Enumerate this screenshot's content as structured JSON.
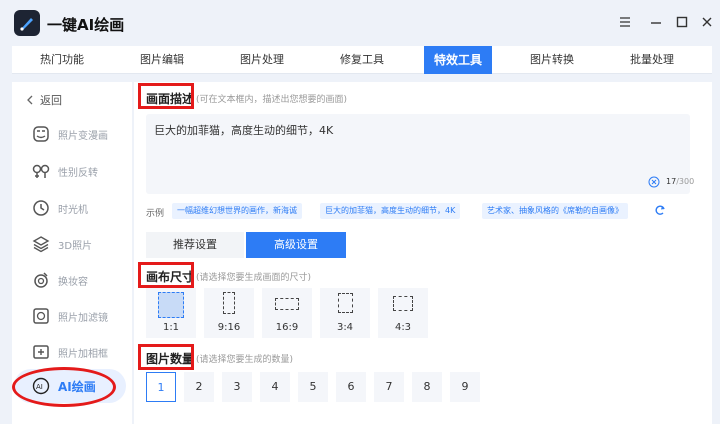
{
  "app": {
    "title": "一键AI绘画"
  },
  "tabs": [
    {
      "label": "热门功能"
    },
    {
      "label": "图片编辑"
    },
    {
      "label": "图片处理"
    },
    {
      "label": "修复工具"
    },
    {
      "label": "特效工具",
      "active": true
    },
    {
      "label": "图片转换"
    },
    {
      "label": "批量处理"
    }
  ],
  "sidebar": {
    "back_label": "返回",
    "items": [
      {
        "label": "照片变漫画",
        "icon": "cartoon-face-icon"
      },
      {
        "label": "性别反转",
        "icon": "gender-icon"
      },
      {
        "label": "时光机",
        "icon": "time-machine-icon"
      },
      {
        "label": "3D照片",
        "icon": "layers-icon"
      },
      {
        "label": "换妆容",
        "icon": "makeup-icon"
      },
      {
        "label": "照片加滤镜",
        "icon": "filter-icon"
      },
      {
        "label": "照片加相框",
        "icon": "frame-icon"
      },
      {
        "label": "AI绘画",
        "icon": "ai-paint-icon",
        "active": true
      }
    ]
  },
  "description": {
    "title": "画面描述",
    "hint": "(可在文本框内，描述出您想要的画面)",
    "value": "巨大的加菲猫，高度生动的细节，4K",
    "count": "17",
    "max": "/300"
  },
  "examples": {
    "label": "示例",
    "chips": [
      "一幅超维幻想世界的画作，新海诚",
      "巨大的加菲猫，高度生动的细节，4K",
      "艺术家、抽象风格的《席勒的自画像》"
    ]
  },
  "settings_tabs": {
    "recommended": "推荐设置",
    "advanced": "高级设置"
  },
  "canvas": {
    "title": "画布尺寸",
    "hint": "(请选择您要生成画面的尺寸)",
    "ratios": [
      "1:1",
      "9:16",
      "16:9",
      "3:4",
      "4:3"
    ],
    "selected": "1:1"
  },
  "image_count": {
    "title": "图片数量",
    "hint": "(请选择您要生成的数量)",
    "options": [
      "1",
      "2",
      "3",
      "4",
      "5",
      "6",
      "7",
      "8",
      "9"
    ],
    "selected": "1"
  },
  "colors": {
    "accent": "#2d7cf5",
    "highlight": "#e41a1a",
    "background": "#eef2f9"
  }
}
